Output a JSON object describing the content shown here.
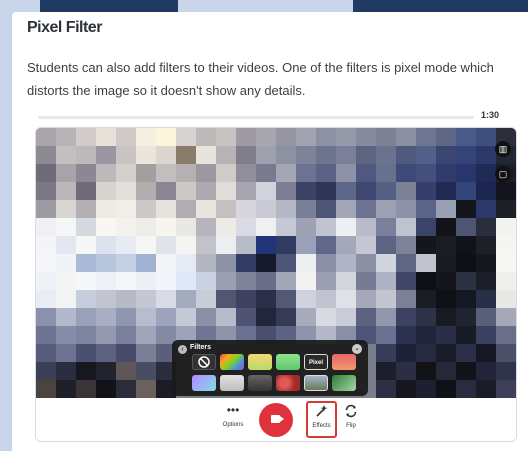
{
  "section": {
    "title": "Pixel Filter",
    "body": "Students can also add filters to their videos. One of the filters is pixel mode which distorts the image so it doesn't show any details."
  },
  "player": {
    "duration": "1:30"
  },
  "filters_panel": {
    "title": "Filters",
    "selected_label": "Pixel",
    "swatches_row1": [
      "none",
      "rainbow",
      "warm",
      "green",
      "pixel",
      "sunset"
    ],
    "swatches_row2": [
      "pastel",
      "gray",
      "dark",
      "red",
      "photo",
      "alien"
    ]
  },
  "toolbar": {
    "options_label": "Options",
    "effects_label": "Effects",
    "flip_label": "Flip"
  },
  "colors": {
    "record": "#e0323c",
    "highlight": "#d63b2f",
    "page_bg": "#1f3a63"
  }
}
